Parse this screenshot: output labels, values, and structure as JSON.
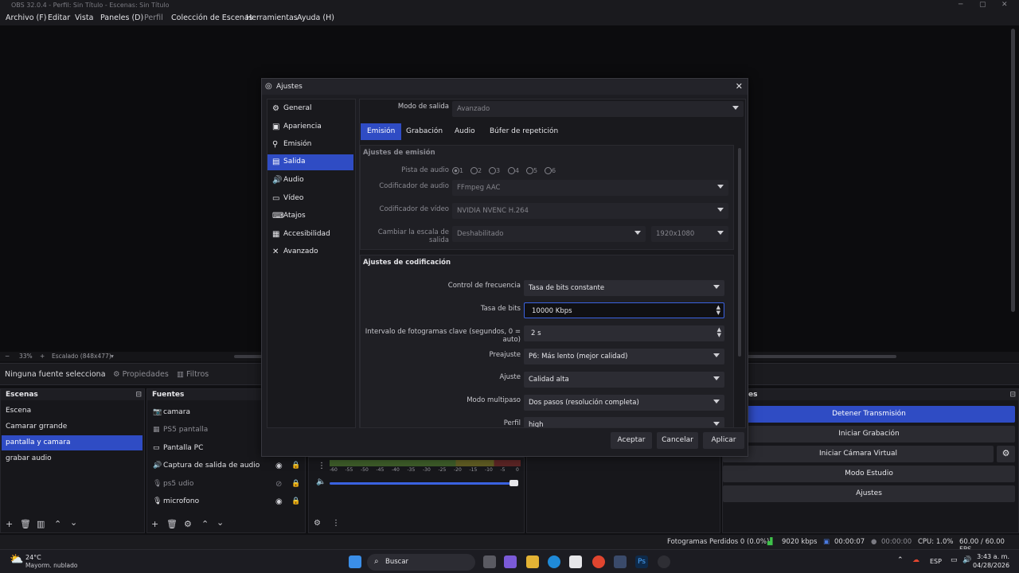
{
  "window": {
    "title": "OBS 32.0.4 - Perfil: Sin Título - Escenas: Sin Título"
  },
  "menu": [
    "Archivo (F)",
    "Editar",
    "Vista",
    "Paneles (D)",
    "Perfil",
    "Colección de Escenas",
    "Herramientas",
    "Ayuda (H)"
  ],
  "zoom": {
    "minus": "−",
    "value": "33%",
    "plus": "+",
    "scale": "Escalado (848x477)"
  },
  "context": {
    "no_source": "Ninguna fuente selecciona",
    "properties": "Propiedades",
    "filters": "Filtros"
  },
  "scenes": {
    "title": "Escenas",
    "items": [
      "Escena",
      "Camarar grrande",
      "pantalla y camara",
      "grabar audio"
    ]
  },
  "sources": {
    "title": "Fuentes",
    "items": [
      "camara",
      "PS5 pantalla",
      "Pantalla PC",
      "Captura de salida de audio",
      "ps5 udio",
      "microfono"
    ]
  },
  "mixer": {
    "ticks": [
      "-60",
      "-55",
      "-50",
      "-45",
      "-40",
      "-35",
      "-30",
      "-25",
      "-20",
      "-15",
      "-10",
      "-5",
      "0"
    ]
  },
  "controls": {
    "title": "es",
    "buttons": [
      "Detener Transmisión",
      "Iniciar Grabación",
      "Iniciar Cámara Virtual",
      "Modo Estudio",
      "Ajustes"
    ]
  },
  "status": {
    "dropped": "Fotogramas Perdidos 0 (0.0%)",
    "bitrate": "9020 kbps",
    "stream_time": "00:00:07",
    "rec_time": "00:00:00",
    "cpu": "CPU: 1.0%",
    "fps": "60.00 / 60.00 FPS"
  },
  "taskbar": {
    "temp": "24°C",
    "weather": "Mayorm. nublado",
    "search": "Buscar",
    "lang": "ESP",
    "time": "3:43 a. m.",
    "date": "04/28/2026"
  },
  "dialog": {
    "title": "Ajustes",
    "nav": [
      "General",
      "Apariencia",
      "Emisión",
      "Salida",
      "Audio",
      "Vídeo",
      "Atajos",
      "Accesibilidad",
      "Avanzado"
    ],
    "output_mode_label": "Modo de salida",
    "output_mode": "Avanzado",
    "tabs": [
      "Emisión",
      "Grabación",
      "Audio",
      "Búfer de repetición"
    ],
    "stream_section": "Ajustes de emisión",
    "audio_track_label": "Pista de audio",
    "tracks": [
      "1",
      "2",
      "3",
      "4",
      "5",
      "6"
    ],
    "audio_encoder_label": "Codificador de audio",
    "audio_encoder": "FFmpeg AAC",
    "video_encoder_label": "Codificador de vídeo",
    "video_encoder": "NVIDIA NVENC H.264",
    "rescale_label": "Cambiar la escala de salida",
    "rescale": "Deshabilitado",
    "rescale_res": "1920x1080",
    "encoding_section": "Ajustes de codificación",
    "rate_control_label": "Control de frecuencia",
    "rate_control": "Tasa de bits constante",
    "bitrate_label": "Tasa de bits",
    "bitrate": "10000 Kbps",
    "keyframe_label": "Intervalo de fotogramas clave (segundos, 0 = auto)",
    "keyframe": "2 s",
    "preset_label": "Preajuste",
    "preset": "P6: Más lento (mejor calidad)",
    "tune_label": "Ajuste",
    "tune": "Calidad alta",
    "multipass_label": "Modo multipaso",
    "multipass": "Dos pasos (resolución completa)",
    "profile_label": "Perfil",
    "profile": "high",
    "buttons": {
      "ok": "Aceptar",
      "cancel": "Cancelar",
      "apply": "Aplicar"
    }
  },
  "colors": {
    "accent": "#2f4cc4",
    "bg": "#101013",
    "panel": "#17171b"
  }
}
